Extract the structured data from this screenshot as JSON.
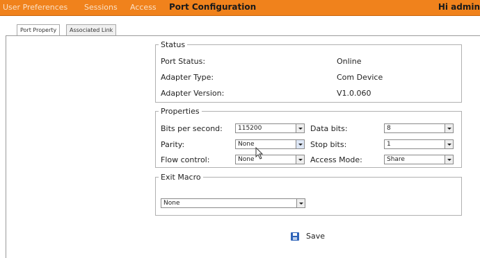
{
  "nav": {
    "user_preferences": "User Preferences",
    "sessions": "Sessions",
    "access": "Access",
    "port_configuration": "Port Configuration",
    "greeting": "Hi admin"
  },
  "tabs": {
    "port_property": "Port Property",
    "associated_link": "Associated Link"
  },
  "status": {
    "legend": "Status",
    "port_status_label": "Port Status:",
    "port_status_value": "Online",
    "adapter_type_label": "Adapter Type:",
    "adapter_type_value": "Com Device",
    "adapter_version_label": "Adapter Version:",
    "adapter_version_value": "V1.0.060"
  },
  "properties": {
    "legend": "Properties",
    "bits_per_second_label": "Bits per second:",
    "bits_per_second_value": "115200",
    "data_bits_label": "Data bits:",
    "data_bits_value": "8",
    "parity_label": "Parity:",
    "parity_value": "None",
    "stop_bits_label": "Stop bits:",
    "stop_bits_value": "1",
    "flow_control_label": "Flow control:",
    "flow_control_value": "None",
    "access_mode_label": "Access Mode:",
    "access_mode_value": "Share"
  },
  "exit_macro": {
    "legend": "Exit Macro",
    "value": "None"
  },
  "actions": {
    "save_label": "Save",
    "save_icon": "floppy-disk-icon"
  },
  "colors": {
    "topbar": "#f0821c",
    "save_icon": "#2e63b8"
  }
}
